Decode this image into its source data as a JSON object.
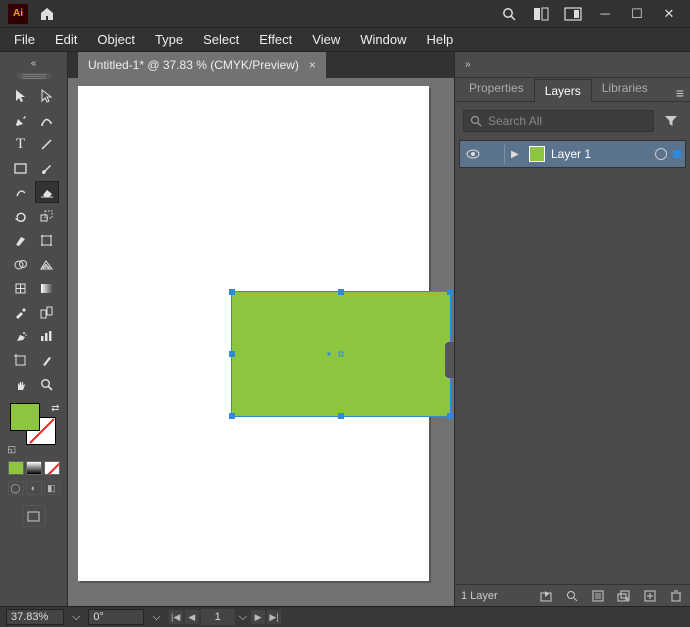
{
  "app": {
    "logo": "Ai"
  },
  "menu": {
    "file": "File",
    "edit": "Edit",
    "object": "Object",
    "type": "Type",
    "select": "Select",
    "effect": "Effect",
    "view": "View",
    "window": "Window",
    "help": "Help"
  },
  "document": {
    "tab_title": "Untitled-1* @ 37.83 % (CMYK/Preview)",
    "close_glyph": "×"
  },
  "colors": {
    "fill": "#8cc63f",
    "stroke": "none",
    "selection": "#2f89dd"
  },
  "panels": {
    "properties": "Properties",
    "layers": "Layers",
    "libraries": "Libraries",
    "search_placeholder": "Search All"
  },
  "layers": {
    "items": [
      {
        "name": "Layer 1",
        "visible": true,
        "color": "#2f89dd",
        "thumb": "#8cc63f",
        "selected": true
      }
    ],
    "count_label": "1 Layer"
  },
  "status": {
    "zoom": "37.83%",
    "rotate": "0°",
    "artboard_num": "1"
  }
}
